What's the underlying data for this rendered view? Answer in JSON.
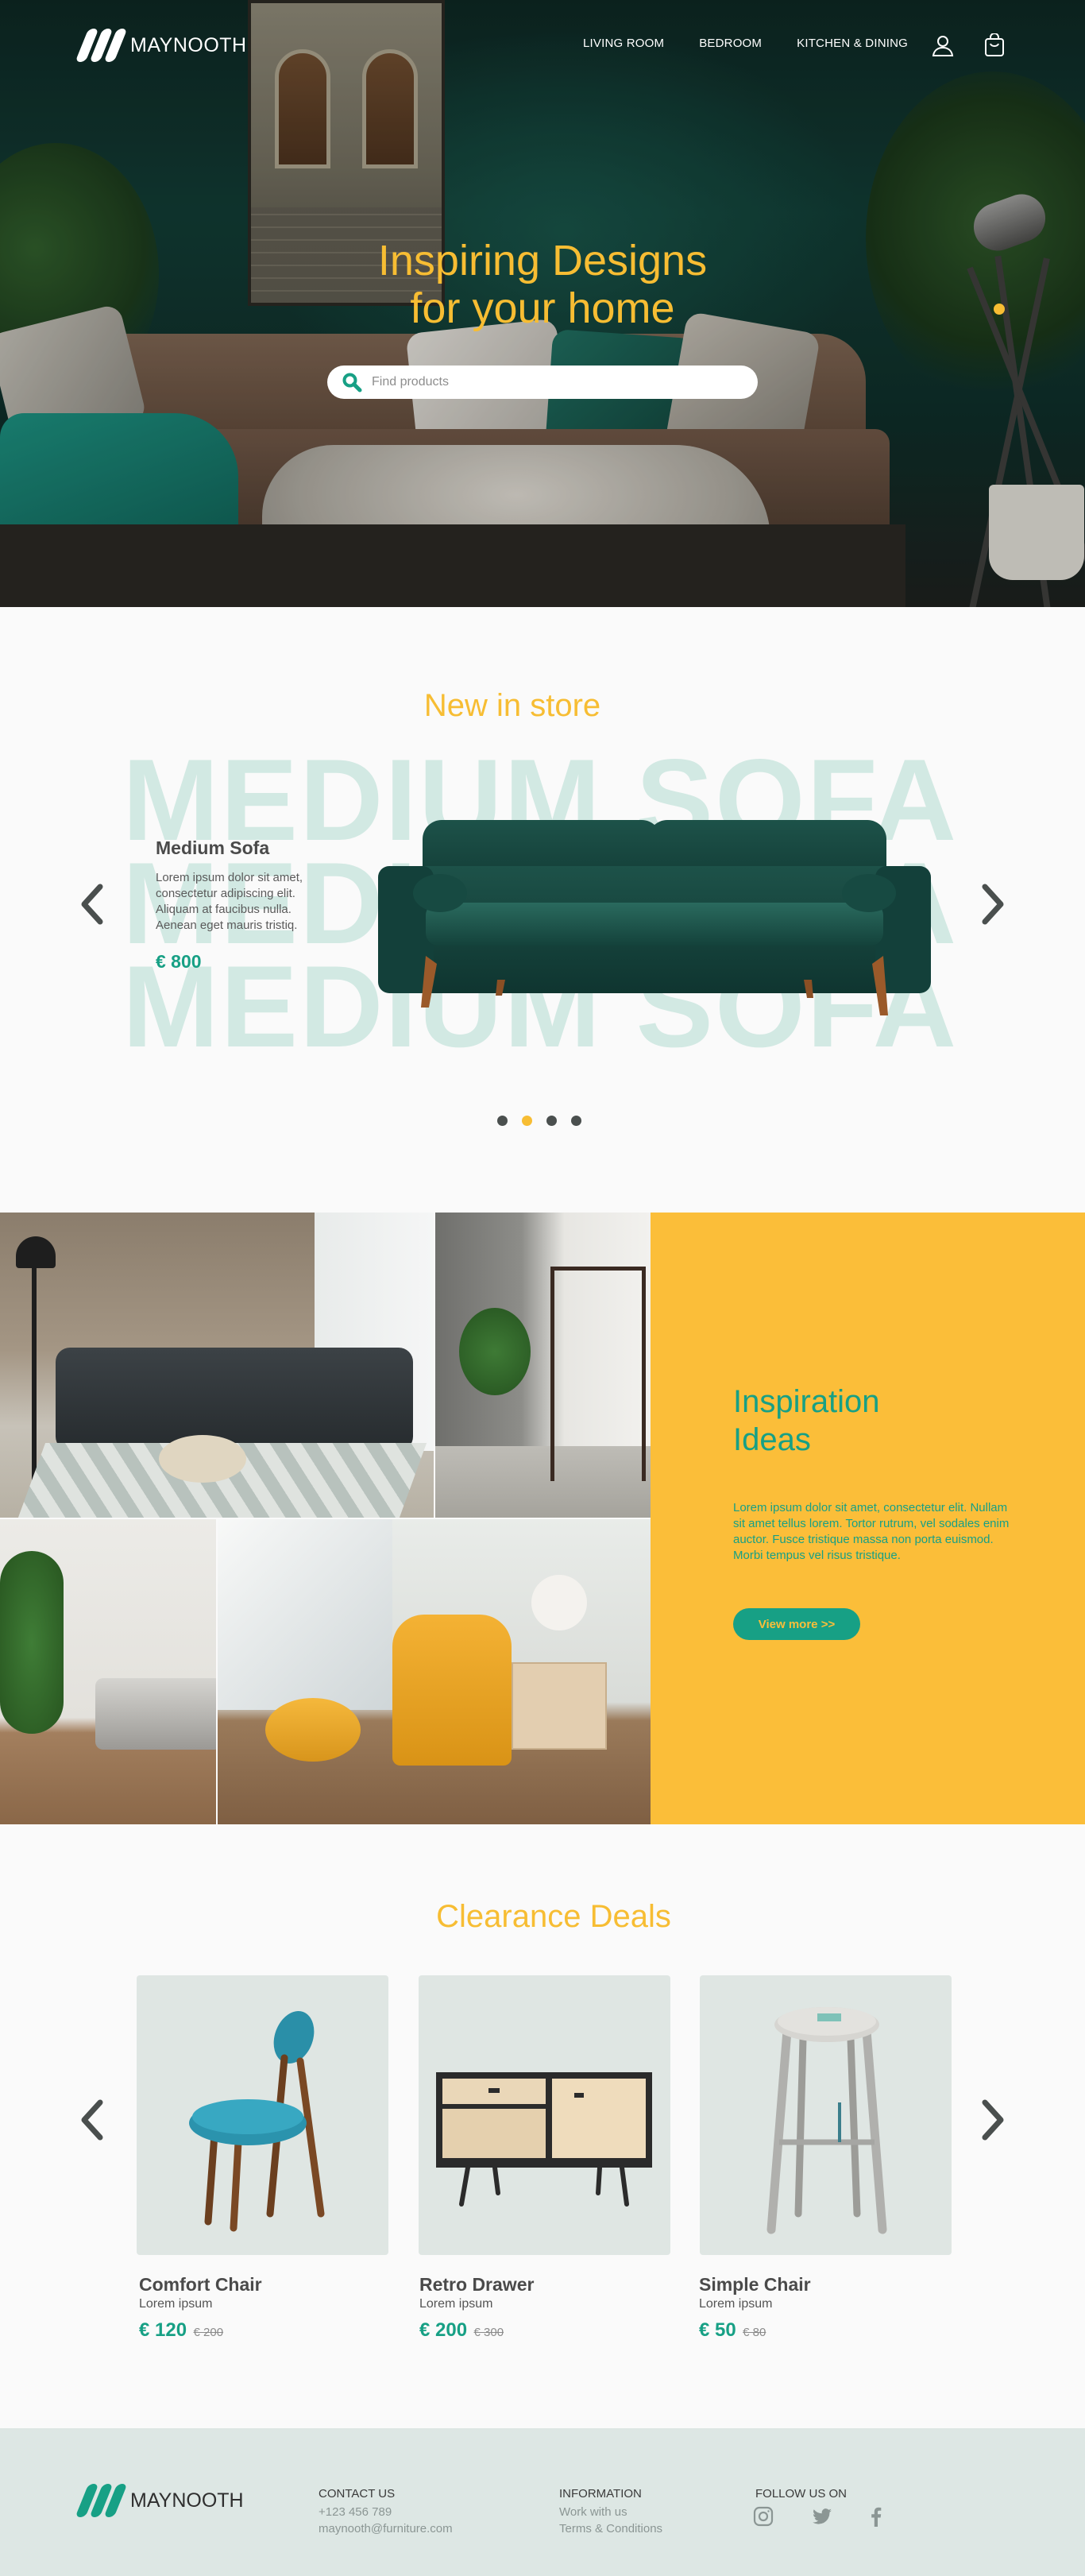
{
  "brand": {
    "name": "MAYNOOTH"
  },
  "nav": {
    "items": [
      "LIVING ROOM",
      "BEDROOM",
      "KITCHEN & DINING"
    ],
    "account_icon": "user-icon",
    "cart_icon": "shopping-bag-icon"
  },
  "hero": {
    "title_line1": "Inspiring Designs",
    "title_line2": "for your home",
    "search_placeholder": "Find products",
    "search_icon": "search-icon"
  },
  "new_in_store": {
    "title": "New in store",
    "background_word": "MEDIUM SOFA",
    "product_name": "Medium Sofa",
    "description": "Lorem ipsum dolor sit amet, consectetur adipiscing elit. Aliquam at faucibus nulla. Aenean eget mauris tristiq.",
    "price": "€ 800",
    "slides_total": 4,
    "active_slide": 2
  },
  "inspiration": {
    "title": "Inspiration Ideas",
    "text": "Lorem ipsum dolor sit amet, consectetur  elit. Nullam sit amet tellus lorem. Tortor rutrum, vel sodales enim auctor. Fusce tristique massa non porta euismod. Morbi tempus vel risus tristique.",
    "button_label": "View more   >>"
  },
  "clearance": {
    "title": "Clearance Deals",
    "products": [
      {
        "name": "Comfort Chair",
        "subtitle": "Lorem ipsum",
        "price": "€ 120",
        "old_price": "€ 200"
      },
      {
        "name": "Retro Drawer",
        "subtitle": "Lorem ipsum",
        "price": "€ 200",
        "old_price": "€ 300"
      },
      {
        "name": "Simple Chair",
        "subtitle": "Lorem ipsum",
        "price": "€ 50",
        "old_price": "€ 80"
      }
    ]
  },
  "footer": {
    "contact_title": "CONTACT US",
    "phone": "+123 456 789",
    "email": "maynooth@furniture.com",
    "info_title": "INFORMATION",
    "info_links": [
      "Work with us",
      "Terms & Conditions"
    ],
    "follow_title": "FOLLOW US ON",
    "social_icons": [
      "instagram-icon",
      "twitter-icon",
      "facebook-icon"
    ]
  },
  "colors": {
    "accent_yellow": "#f7bd33",
    "accent_teal": "#17a085",
    "panel_yellow": "#fbbe39",
    "footer_bg": "#dde7e4",
    "card_bg": "#dfe6e3"
  }
}
